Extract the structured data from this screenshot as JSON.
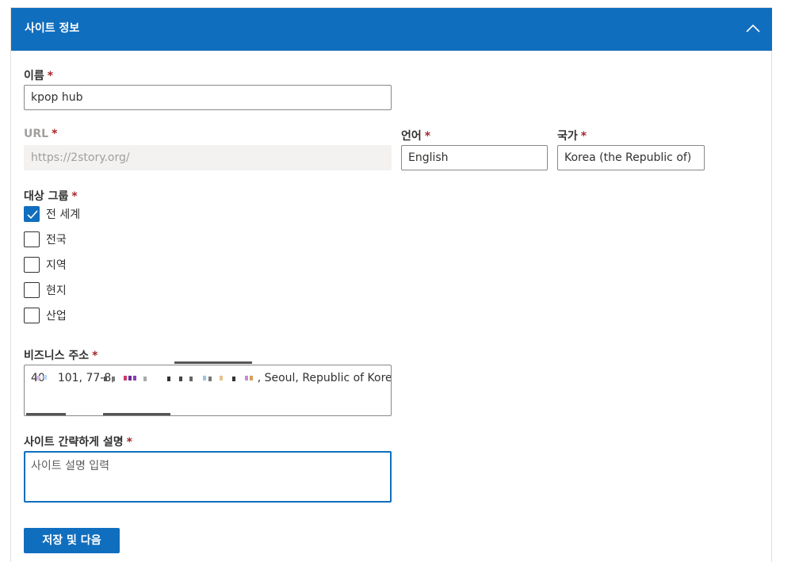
{
  "panel": {
    "title": "사이트 정보"
  },
  "form": {
    "name": {
      "label": "이름",
      "required": "*",
      "value": "kpop hub"
    },
    "url": {
      "label": "URL",
      "required": "*",
      "value": "https://2story.org/"
    },
    "language": {
      "label": "언어",
      "required": "*",
      "value": "English"
    },
    "country": {
      "label": "국가",
      "required": "*",
      "value": "Korea (the Republic of)"
    },
    "audience": {
      "label": "대상 그룹",
      "required": "*",
      "options": [
        {
          "label": "전 세계",
          "checked": true
        },
        {
          "label": "전국",
          "checked": false
        },
        {
          "label": "지역",
          "checked": false
        },
        {
          "label": "현지",
          "checked": false
        },
        {
          "label": "산업",
          "checked": false
        }
      ]
    },
    "address": {
      "label": "비즈니스 주소",
      "required": "*",
      "value_prefix": "40",
      "value_mid": "101, 77-8,",
      "value_suffix": ", Seoul, Republic of Korea"
    },
    "description": {
      "label": "사이트 간략하게 설명",
      "required": "*",
      "placeholder": "사이트 설명 입력"
    },
    "submit_label": "저장 및 다음"
  },
  "colors": {
    "accent": "#106ebe",
    "required": "#a4262c",
    "disabled": "#a19f9d"
  },
  "icons": {
    "collapse": "chevron-up-icon",
    "check": "checkmark-icon"
  }
}
